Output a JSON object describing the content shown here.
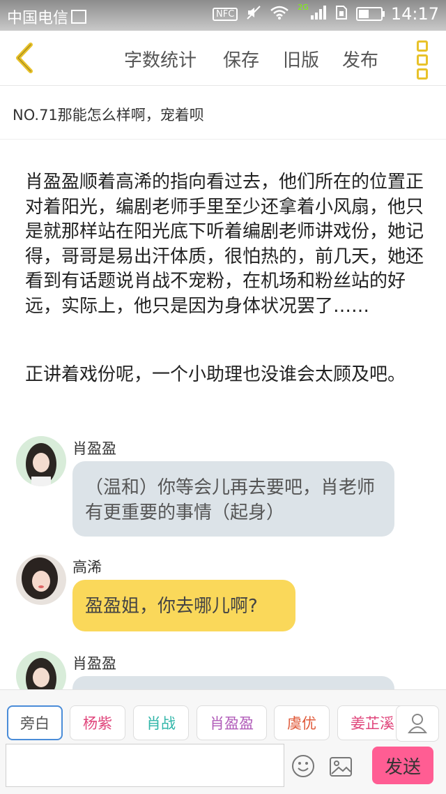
{
  "status_bar": {
    "carrier": "中国电信",
    "nfc": "NFC",
    "network": "2G",
    "time": "14:17",
    "battery_level": 0.45
  },
  "toolbar": {
    "word_count": "字数统计",
    "save": "保存",
    "old_version": "旧版",
    "publish": "发布"
  },
  "chapter": {
    "title": "NO.71那能怎么样啊，宠着呗"
  },
  "narration": [
    "肖盈盈顺着高浠的指向看过去，他们所在的位置正对着阳光，编剧老师手里至少还拿着小风扇，他只是就那样站在阳光底下听着编剧老师讲戏份，她记得，哥哥是易出汗体质，很怕热的，前几天，她还看到有话题说肖战不宠粉，在机场和粉丝站的好远，实际上，他只是因为身体状况罢了……",
    "正讲着戏份呢，一个小助理也没谁会太顾及吧。"
  ],
  "messages": [
    {
      "sender": "肖盈盈",
      "text": "（温和）你等会儿再去要吧，肖老师有更重要的事情（起身）"
    },
    {
      "sender": "高浠",
      "text": "盈盈姐，你去哪儿啊?"
    },
    {
      "sender": "肖盈盈",
      "text": ""
    }
  ],
  "roles": [
    {
      "label": "旁白",
      "color": "#555555"
    },
    {
      "label": "杨紫",
      "color": "#e0457b"
    },
    {
      "label": "肖战",
      "color": "#2fb5a8"
    },
    {
      "label": "肖盈盈",
      "color": "#b05ab8"
    },
    {
      "label": "虞优",
      "color": "#e05a3a"
    },
    {
      "label": "姜芷溪",
      "color": "#e0457b"
    }
  ],
  "input": {
    "placeholder": "",
    "send": "发送"
  },
  "colors": {
    "accent_yellow": "#fad85a",
    "send_pink": "#ff5d93",
    "bubble_grey": "#dce3e8"
  }
}
